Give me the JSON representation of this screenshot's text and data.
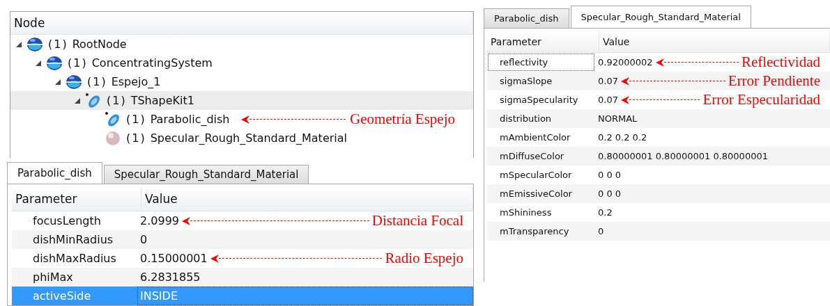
{
  "tree": {
    "header": "Node",
    "items": [
      {
        "count": "(1)",
        "label": "RootNode",
        "kind": "sphere",
        "selected": false,
        "expanded": true,
        "children": [
          {
            "count": "(1)",
            "label": "ConcentratingSystem",
            "kind": "sphere",
            "selected": false,
            "expanded": true,
            "children": [
              {
                "count": "(1)",
                "label": "Espejo_1",
                "kind": "sphere",
                "selected": false,
                "expanded": true,
                "children": [
                  {
                    "count": "(1)",
                    "label": "TShapeKit1",
                    "kind": "shape",
                    "selected": true,
                    "expanded": true,
                    "children": [
                      {
                        "count": "(1)",
                        "label": "Parabolic_dish",
                        "kind": "shape",
                        "selected": false,
                        "annotation": "Geometría Espejo"
                      },
                      {
                        "count": "(1)",
                        "label": "Specular_Rough_Standard_Material",
                        "kind": "material",
                        "selected": false
                      }
                    ]
                  }
                ]
              }
            ]
          }
        ]
      }
    ]
  },
  "left_panel": {
    "tabs": [
      {
        "label": "Parabolic_dish",
        "selected": true
      },
      {
        "label": "Specular_Rough_Standard_Material",
        "selected": false
      }
    ],
    "columns": [
      "Parameter",
      "Value"
    ],
    "rows": [
      {
        "parameter": "focusLength",
        "value": "2.0999",
        "selected": false,
        "focused": false,
        "annotation": "Distancia Focal"
      },
      {
        "parameter": "dishMinRadius",
        "value": "0",
        "selected": false,
        "focused": false
      },
      {
        "parameter": "dishMaxRadius",
        "value": "0.15000001",
        "selected": false,
        "focused": false,
        "annotation": "Radio Espejo"
      },
      {
        "parameter": "phiMax",
        "value": "6.2831855",
        "selected": false,
        "focused": false
      },
      {
        "parameter": "activeSide",
        "value": "INSIDE",
        "selected": true,
        "focused": true
      }
    ]
  },
  "right_panel": {
    "tabs": [
      {
        "label": "Parabolic_dish",
        "selected": false
      },
      {
        "label": "Specular_Rough_Standard_Material",
        "selected": true
      }
    ],
    "columns": [
      "Parameter",
      "Value"
    ],
    "rows": [
      {
        "parameter": "reflectivity",
        "value": "0.92000002",
        "selected": false,
        "focused": true,
        "annotation": "Reflectividad"
      },
      {
        "parameter": "sigmaSlope",
        "value": "0.07",
        "selected": false,
        "focused": false,
        "annotation": "Error Pendiente"
      },
      {
        "parameter": "sigmaSpecularity",
        "value": "0.07",
        "selected": false,
        "focused": false,
        "annotation": "Error Especularidad"
      },
      {
        "parameter": "distribution",
        "value": "NORMAL",
        "selected": false,
        "focused": false
      },
      {
        "parameter": "mAmbientColor",
        "value": "0.2 0.2 0.2",
        "selected": false,
        "focused": false
      },
      {
        "parameter": "mDiffuseColor",
        "value": "0.80000001 0.80000001 0.80000001",
        "selected": false,
        "focused": false
      },
      {
        "parameter": "mSpecularColor",
        "value": "0 0 0",
        "selected": false,
        "focused": false
      },
      {
        "parameter": "mEmissiveColor",
        "value": "0 0 0",
        "selected": false,
        "focused": false
      },
      {
        "parameter": "mShininess",
        "value": "0.2",
        "selected": false,
        "focused": false
      },
      {
        "parameter": "mTransparency",
        "value": "0",
        "selected": false,
        "focused": false
      }
    ]
  }
}
